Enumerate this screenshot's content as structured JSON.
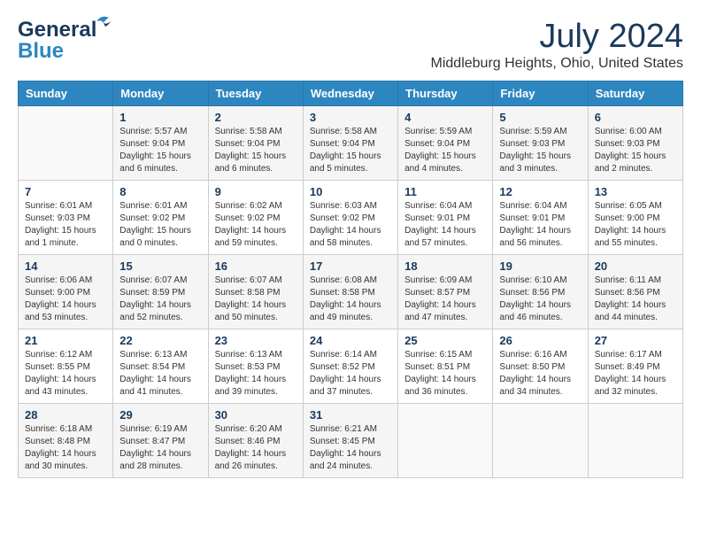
{
  "header": {
    "logo_line1": "General",
    "logo_line2": "Blue",
    "month_year": "July 2024",
    "location": "Middleburg Heights, Ohio, United States"
  },
  "days_of_week": [
    "Sunday",
    "Monday",
    "Tuesday",
    "Wednesday",
    "Thursday",
    "Friday",
    "Saturday"
  ],
  "weeks": [
    [
      {
        "day": "",
        "info": ""
      },
      {
        "day": "1",
        "info": "Sunrise: 5:57 AM\nSunset: 9:04 PM\nDaylight: 15 hours\nand 6 minutes."
      },
      {
        "day": "2",
        "info": "Sunrise: 5:58 AM\nSunset: 9:04 PM\nDaylight: 15 hours\nand 6 minutes."
      },
      {
        "day": "3",
        "info": "Sunrise: 5:58 AM\nSunset: 9:04 PM\nDaylight: 15 hours\nand 5 minutes."
      },
      {
        "day": "4",
        "info": "Sunrise: 5:59 AM\nSunset: 9:04 PM\nDaylight: 15 hours\nand 4 minutes."
      },
      {
        "day": "5",
        "info": "Sunrise: 5:59 AM\nSunset: 9:03 PM\nDaylight: 15 hours\nand 3 minutes."
      },
      {
        "day": "6",
        "info": "Sunrise: 6:00 AM\nSunset: 9:03 PM\nDaylight: 15 hours\nand 2 minutes."
      }
    ],
    [
      {
        "day": "7",
        "info": "Sunrise: 6:01 AM\nSunset: 9:03 PM\nDaylight: 15 hours\nand 1 minute."
      },
      {
        "day": "8",
        "info": "Sunrise: 6:01 AM\nSunset: 9:02 PM\nDaylight: 15 hours\nand 0 minutes."
      },
      {
        "day": "9",
        "info": "Sunrise: 6:02 AM\nSunset: 9:02 PM\nDaylight: 14 hours\nand 59 minutes."
      },
      {
        "day": "10",
        "info": "Sunrise: 6:03 AM\nSunset: 9:02 PM\nDaylight: 14 hours\nand 58 minutes."
      },
      {
        "day": "11",
        "info": "Sunrise: 6:04 AM\nSunset: 9:01 PM\nDaylight: 14 hours\nand 57 minutes."
      },
      {
        "day": "12",
        "info": "Sunrise: 6:04 AM\nSunset: 9:01 PM\nDaylight: 14 hours\nand 56 minutes."
      },
      {
        "day": "13",
        "info": "Sunrise: 6:05 AM\nSunset: 9:00 PM\nDaylight: 14 hours\nand 55 minutes."
      }
    ],
    [
      {
        "day": "14",
        "info": "Sunrise: 6:06 AM\nSunset: 9:00 PM\nDaylight: 14 hours\nand 53 minutes."
      },
      {
        "day": "15",
        "info": "Sunrise: 6:07 AM\nSunset: 8:59 PM\nDaylight: 14 hours\nand 52 minutes."
      },
      {
        "day": "16",
        "info": "Sunrise: 6:07 AM\nSunset: 8:58 PM\nDaylight: 14 hours\nand 50 minutes."
      },
      {
        "day": "17",
        "info": "Sunrise: 6:08 AM\nSunset: 8:58 PM\nDaylight: 14 hours\nand 49 minutes."
      },
      {
        "day": "18",
        "info": "Sunrise: 6:09 AM\nSunset: 8:57 PM\nDaylight: 14 hours\nand 47 minutes."
      },
      {
        "day": "19",
        "info": "Sunrise: 6:10 AM\nSunset: 8:56 PM\nDaylight: 14 hours\nand 46 minutes."
      },
      {
        "day": "20",
        "info": "Sunrise: 6:11 AM\nSunset: 8:56 PM\nDaylight: 14 hours\nand 44 minutes."
      }
    ],
    [
      {
        "day": "21",
        "info": "Sunrise: 6:12 AM\nSunset: 8:55 PM\nDaylight: 14 hours\nand 43 minutes."
      },
      {
        "day": "22",
        "info": "Sunrise: 6:13 AM\nSunset: 8:54 PM\nDaylight: 14 hours\nand 41 minutes."
      },
      {
        "day": "23",
        "info": "Sunrise: 6:13 AM\nSunset: 8:53 PM\nDaylight: 14 hours\nand 39 minutes."
      },
      {
        "day": "24",
        "info": "Sunrise: 6:14 AM\nSunset: 8:52 PM\nDaylight: 14 hours\nand 37 minutes."
      },
      {
        "day": "25",
        "info": "Sunrise: 6:15 AM\nSunset: 8:51 PM\nDaylight: 14 hours\nand 36 minutes."
      },
      {
        "day": "26",
        "info": "Sunrise: 6:16 AM\nSunset: 8:50 PM\nDaylight: 14 hours\nand 34 minutes."
      },
      {
        "day": "27",
        "info": "Sunrise: 6:17 AM\nSunset: 8:49 PM\nDaylight: 14 hours\nand 32 minutes."
      }
    ],
    [
      {
        "day": "28",
        "info": "Sunrise: 6:18 AM\nSunset: 8:48 PM\nDaylight: 14 hours\nand 30 minutes."
      },
      {
        "day": "29",
        "info": "Sunrise: 6:19 AM\nSunset: 8:47 PM\nDaylight: 14 hours\nand 28 minutes."
      },
      {
        "day": "30",
        "info": "Sunrise: 6:20 AM\nSunset: 8:46 PM\nDaylight: 14 hours\nand 26 minutes."
      },
      {
        "day": "31",
        "info": "Sunrise: 6:21 AM\nSunset: 8:45 PM\nDaylight: 14 hours\nand 24 minutes."
      },
      {
        "day": "",
        "info": ""
      },
      {
        "day": "",
        "info": ""
      },
      {
        "day": "",
        "info": ""
      }
    ]
  ]
}
